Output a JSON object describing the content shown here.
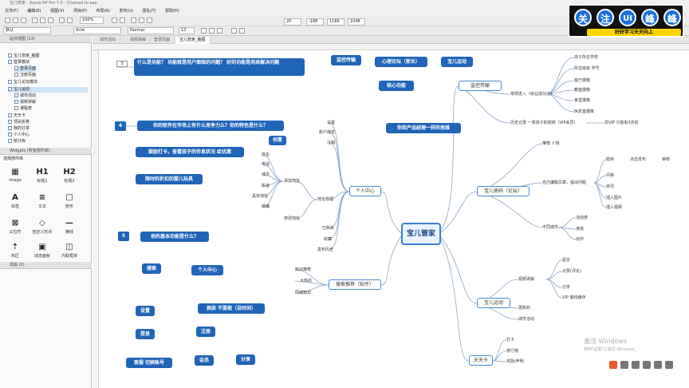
{
  "window": {
    "title": "宝儿管家 - Axure RP Pro 7.0 - Chained to aaa"
  },
  "menu": [
    "文件(F)",
    "编辑(E)",
    "视图(V)",
    "项目(P)",
    "布局(A)",
    "发布(U)",
    "团队(T)",
    "帮助(H)"
  ],
  "toolbar": {
    "zoom": "100%",
    "font_family": "Arial",
    "font_style": "Normal",
    "font_size": "13",
    "x_value": "20",
    "y_value": "-188",
    "w_value": "1166",
    "h_value": "1048",
    "style_value": "默认"
  },
  "sitemap": {
    "header": "站点地图 (13)",
    "items": [
      "宝儿管家_脑图",
      "登录模块",
      "登录页面",
      "注册页面",
      "宝儿论坛模块",
      "宝儿运动",
      "城市活动",
      "视频讲解",
      "课程表",
      "天天卡",
      "顶尖折券",
      "我的订单",
      "个人中心",
      "统计库"
    ]
  },
  "widgets": {
    "header": "Widgets (所有部件库)",
    "library": "选择部件库",
    "items": [
      "image",
      "标题1",
      "标题2",
      "标签",
      "文本",
      "矩形",
      "占位符",
      "自定义形状",
      "横线",
      "热区",
      "动态面板",
      "内联框架"
    ]
  },
  "masters": {
    "header": "母版 (0)"
  },
  "tabs": [
    "城市活动",
    "视频讲解",
    "登录页面",
    "宝儿管家_脑图"
  ],
  "left_notes": {
    "n3": "3",
    "q3": "什么是功能？ 功能就是用户面临的问题？ 好的功能是用来解决问题",
    "n4": "4",
    "q4": "你的软件在市场上有什么竞争力么？你的特色是什么？",
    "b4a": "鼓励打卡，查看孩子的作息状况 给优惠",
    "b4b": "限时的折扣的婴儿玩具",
    "b4c": "创意",
    "n5": "5",
    "q5": "他的基本功能是什么？",
    "f1": "搜索",
    "f2": "个人中心",
    "f3": "设置",
    "f4": "换肤 不要做（没时间）",
    "f5": "登录",
    "f6": "注册",
    "f7": "客服 切换账号",
    "f8": "会员",
    "f9": "分享"
  },
  "top_buttons": {
    "t1": "监控传输",
    "t2": "心理论坛（家长）",
    "t3": "宝儿运动",
    "t4": "核心功能",
    "t5": "你和产品经理一样的思维"
  },
  "mindmap": {
    "center": "宝儿管家",
    "branch_monitor": "监控传输",
    "monitor_sub1": "常规进入（就业成功了）",
    "monitor_sub2": "历史记录 一周孩子的视频（VIP会员）",
    "monitor_leaves": [
      "孩子所在学校",
      "所在班级 学号",
      "客厅摄像",
      "教室摄像",
      "食堂摄像",
      "休息室摄像"
    ],
    "monitor_vip": "非VIP 只能看3天的",
    "branch_forum": "宝儿爸妈（论坛）",
    "forum_sub1": "推荐 人热",
    "forum_sub2": "自己编辑文章，提出问题",
    "forum_sub3": "不同城市",
    "forum_leaves": [
      "题目",
      "点击发布",
      "审核",
      "问答",
      "资讯",
      "插入图片",
      "插入视频",
      "活动表",
      "演说",
      "动作"
    ],
    "branch_sport": "宝儿运动",
    "sport_sub1": "视频讲解",
    "sport_sub2": "更新的",
    "sport_sub3": "城市活动",
    "sport_leaves": [
      "留言",
      "点赞(评论)",
      "分享",
      "VIP 离线缓存"
    ],
    "branch_card": "天天卡",
    "card_leaves": [
      "打卡",
      "排行榜",
      "奖励/声明"
    ],
    "branch_personal": "个人中心",
    "personal_sub": [
      "设置",
      "账户绑定",
      "注销",
      "地址管理",
      "已购买",
      "收藏",
      "发布历史"
    ],
    "address_sub": [
      "添加地址",
      "修改地址"
    ],
    "address_fields": [
      "姓名",
      "电话",
      "城市",
      "街道",
      "具体地址",
      "邮编"
    ],
    "branch_search": "搜索推荐（知乎）",
    "search_leaves": [
      "知识推荐",
      "大热的",
      "同城知识"
    ]
  },
  "logo": {
    "chars": [
      "关",
      "注",
      "UI",
      "峰",
      "峰"
    ],
    "sub": "好好学习天天向上"
  },
  "watermark": {
    "line1": "激活 Windows",
    "line2": "转到\"设置\"以激活 Windows。"
  },
  "colors": {
    "accent": "#1f65b8",
    "node_border": "#4a8ad6",
    "center_fill": "#eaf3ff",
    "logo_yellow": "#ffd400"
  }
}
